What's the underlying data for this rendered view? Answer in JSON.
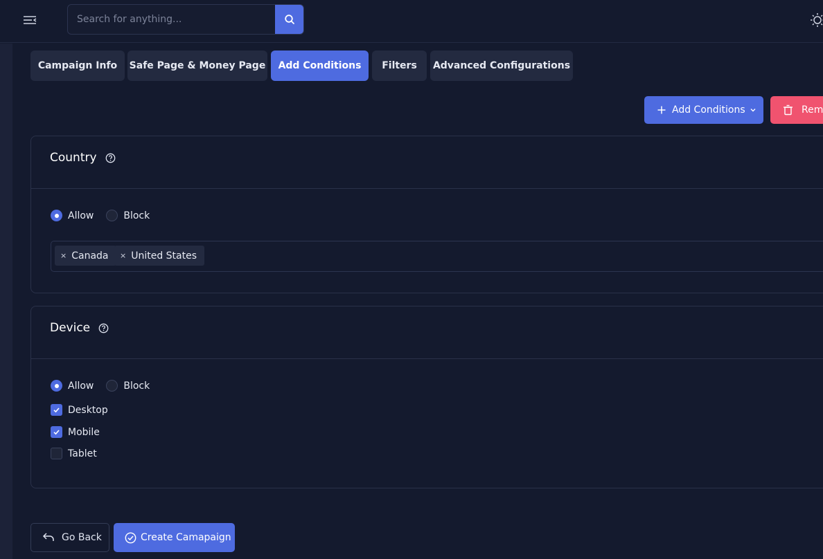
{
  "header": {
    "search_placeholder": "Search for anything..."
  },
  "tabs": [
    {
      "label": "Campaign Info",
      "active": false
    },
    {
      "label": "Safe Page & Money Page",
      "active": false
    },
    {
      "label": "Add Conditions",
      "active": true
    },
    {
      "label": "Filters",
      "active": false
    },
    {
      "label": "Advanced Configurations",
      "active": false
    }
  ],
  "toolbar": {
    "add_conditions_label": "Add Conditions",
    "remove_label": "Remo"
  },
  "country": {
    "title": "Country",
    "allow_label": "Allow",
    "block_label": "Block",
    "mode": "allow",
    "tags": [
      "Canada",
      "United States"
    ]
  },
  "device": {
    "title": "Device",
    "allow_label": "Allow",
    "block_label": "Block",
    "mode": "allow",
    "options": [
      {
        "label": "Desktop",
        "checked": true
      },
      {
        "label": "Mobile",
        "checked": true
      },
      {
        "label": "Tablet",
        "checked": false
      }
    ]
  },
  "footer": {
    "go_back_label": "Go Back",
    "create_label": "Create Camapaign"
  },
  "colors": {
    "accent": "#4e6be0",
    "danger": "#f0536f",
    "background": "#141a2e"
  }
}
